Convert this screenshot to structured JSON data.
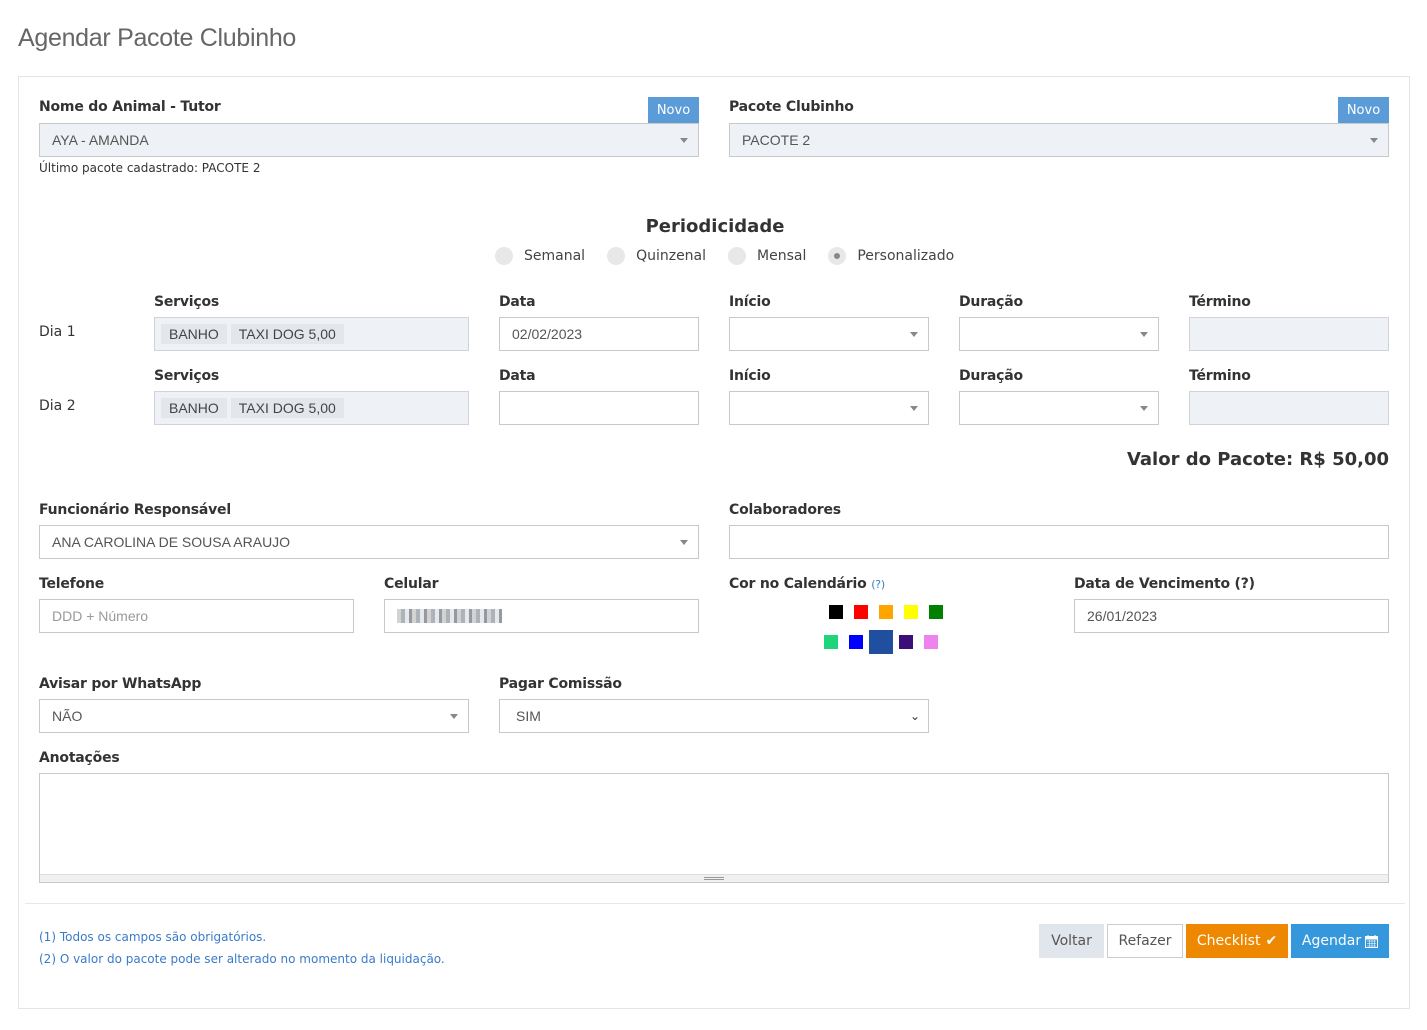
{
  "page": {
    "title": "Agendar Pacote Clubinho"
  },
  "animal": {
    "label": "Nome do Animal - Tutor",
    "novo_label": "Novo",
    "value": "AYA - AMANDA",
    "last_package_note": "Último pacote cadastrado: PACOTE 2"
  },
  "pacote": {
    "label": "Pacote Clubinho",
    "novo_label": "Novo",
    "value": "PACOTE 2"
  },
  "periodicidade": {
    "title": "Periodicidade",
    "options": [
      "Semanal",
      "Quinzenal",
      "Mensal",
      "Personalizado"
    ],
    "selected": "Personalizado"
  },
  "days": [
    {
      "label": "Dia 1",
      "services_label": "Serviços",
      "services": [
        "BANHO",
        "TAXI DOG 5,00"
      ],
      "data_label": "Data",
      "data_value": "02/02/2023",
      "inicio_label": "Início",
      "duracao_label": "Duração",
      "termino_label": "Término"
    },
    {
      "label": "Dia 2",
      "services_label": "Serviços",
      "services": [
        "BANHO",
        "TAXI DOG 5,00"
      ],
      "data_label": "Data",
      "data_value": "",
      "inicio_label": "Início",
      "duracao_label": "Duração",
      "termino_label": "Término"
    }
  ],
  "valor": {
    "text": "Valor do Pacote: R$ 50,00"
  },
  "funcionario": {
    "label": "Funcionário Responsável",
    "value": "ANA CAROLINA DE SOUSA ARAUJO"
  },
  "colaboradores": {
    "label": "Colaboradores",
    "value": ""
  },
  "telefone": {
    "label": "Telefone",
    "placeholder": "DDD + Número"
  },
  "celular": {
    "label": "Celular"
  },
  "cor": {
    "label": "Cor no Calendário",
    "help": "(?)",
    "colors_row1": [
      "#000000",
      "#ff0000",
      "#ffa500",
      "#ffff00",
      "#008000"
    ],
    "colors_row2": [
      "#1fd47a",
      "#0000ff",
      "#1f4f9e",
      "#3a0f7a",
      "#ee82ee"
    ],
    "selected": "#1f4f9e"
  },
  "vencimento": {
    "label": "Data de Vencimento (?)",
    "value": "26/01/2023"
  },
  "whatsapp": {
    "label": "Avisar por WhatsApp",
    "value": "NÃO"
  },
  "comissao": {
    "label": "Pagar Comissão",
    "value": "SIM"
  },
  "anotacoes": {
    "label": "Anotações"
  },
  "footer": {
    "note1": "(1) Todos os campos são obrigatórios.",
    "note2": "(2) O valor do pacote pode ser alterado no momento da liquidação.",
    "voltar": "Voltar",
    "refazer": "Refazer",
    "checklist": "Checklist",
    "agendar": "Agendar"
  }
}
